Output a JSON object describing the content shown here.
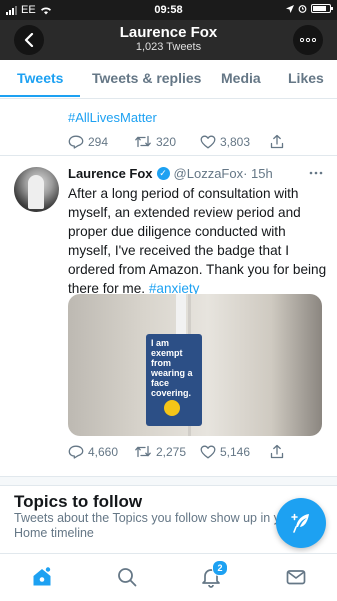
{
  "status_bar": {
    "carrier": "EE",
    "time": "09:58"
  },
  "header": {
    "title": "Laurence Fox",
    "subtitle": "1,023 Tweets"
  },
  "tabs": [
    {
      "label": "Tweets",
      "active": true
    },
    {
      "label": "Tweets & replies",
      "active": false
    },
    {
      "label": "Media",
      "active": false
    },
    {
      "label": "Likes",
      "active": false
    }
  ],
  "previous_tweet": {
    "hashtag": "#AllLivesMatter",
    "replies": "294",
    "retweets": "320",
    "likes": "3,803"
  },
  "tweet": {
    "name": "Laurence Fox",
    "handle": "@LozzaFox",
    "time": "· 15h",
    "text": "After a long period of consultation with myself, an extended review period and proper due diligence conducted with myself, I've received the badge that I ordered from Amazon. Thank you for being there for me.",
    "hashtag": "#anxiety",
    "media_badge_text": "I am exempt from wearing a face covering.",
    "replies": "4,660",
    "retweets": "2,275",
    "likes": "5,146"
  },
  "topics": {
    "title": "Topics to follow",
    "description": "Tweets about the Topics you follow show up in y… Home timeline"
  },
  "bottom_nav": {
    "notifications_count": "2"
  },
  "colors": {
    "accent": "#1da1f2",
    "header_bg": "#2a2a2a",
    "muted": "#657786"
  }
}
